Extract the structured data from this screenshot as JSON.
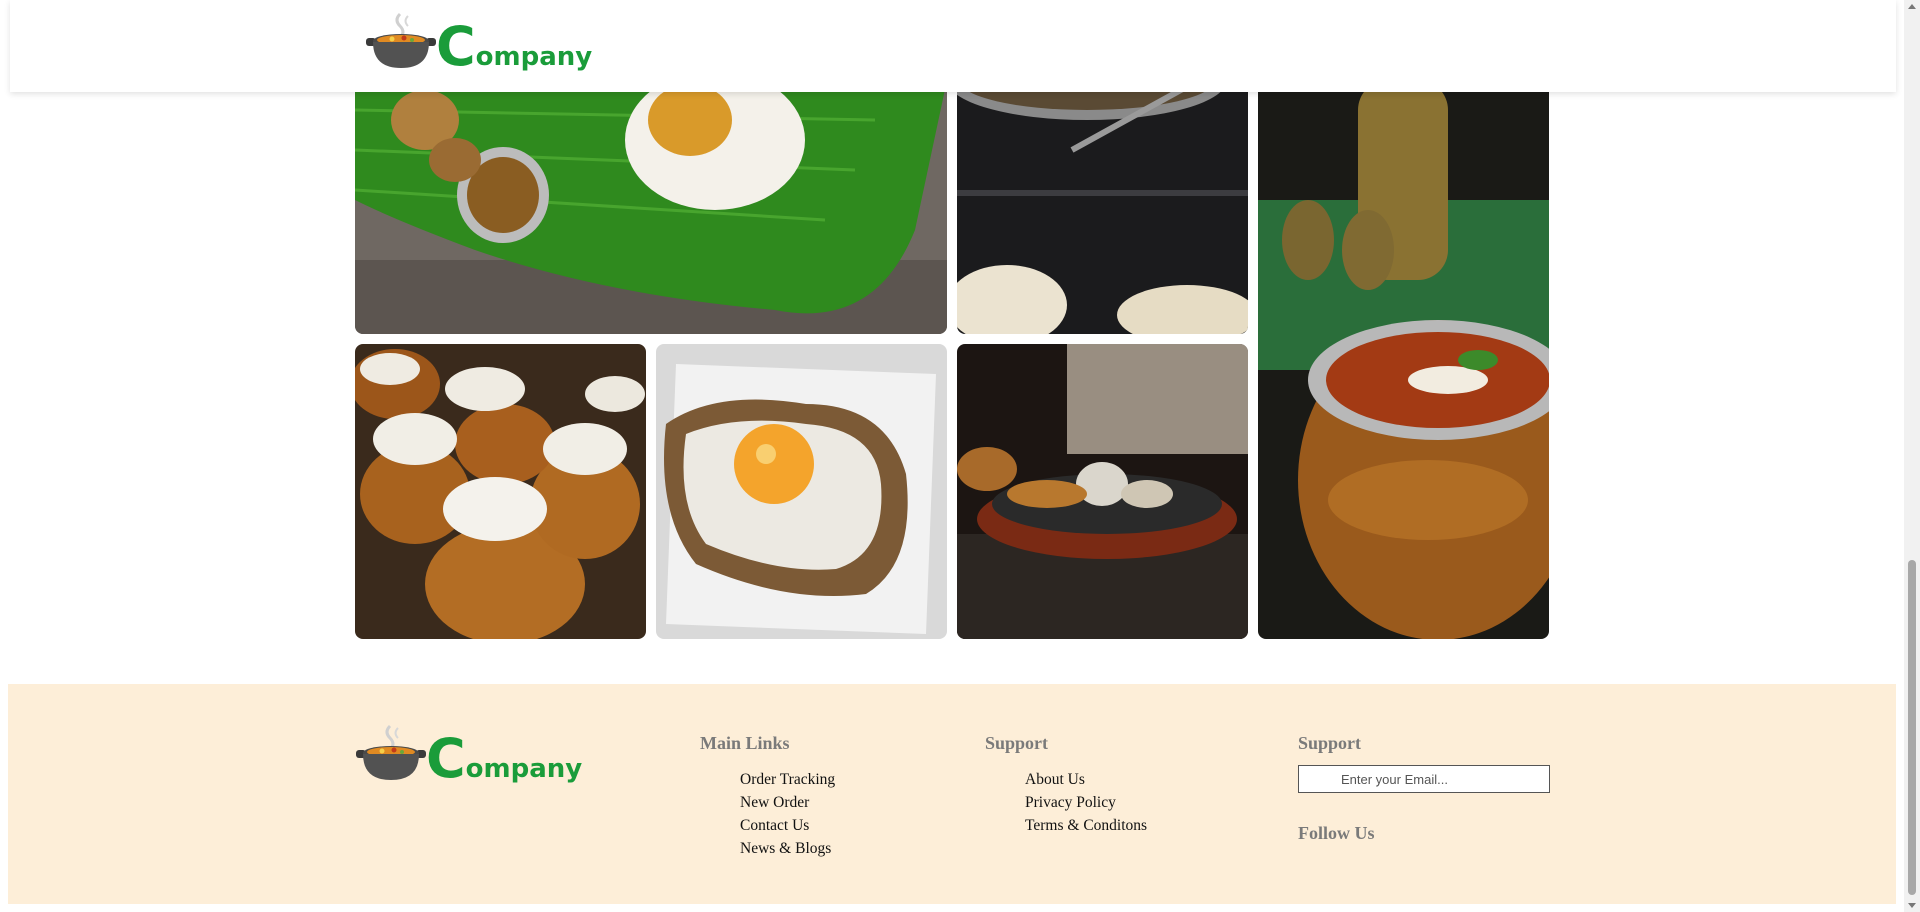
{
  "brand": {
    "logo_initial": "C",
    "logo_rest": "ompany",
    "color": "#1a9c3a"
  },
  "gallery": [
    {
      "name": "banana-leaf-meal"
    },
    {
      "name": "pan-dish"
    },
    {
      "name": "curry-copper-pot"
    },
    {
      "name": "cream-cupcakes"
    },
    {
      "name": "egg-toast"
    },
    {
      "name": "sizzler-platter"
    }
  ],
  "footer": {
    "bg_color": "#fdeed8",
    "main_links": {
      "title": "Main Links",
      "items": [
        "Order Tracking",
        "New Order",
        "Contact Us",
        "News & Blogs"
      ]
    },
    "support_links": {
      "title": "Support",
      "items": [
        "About Us",
        "Privacy Policy",
        "Terms & Conditons"
      ]
    },
    "newsletter": {
      "title": "Support",
      "email_placeholder": "Enter your Email...",
      "follow_title": "Follow Us"
    }
  }
}
